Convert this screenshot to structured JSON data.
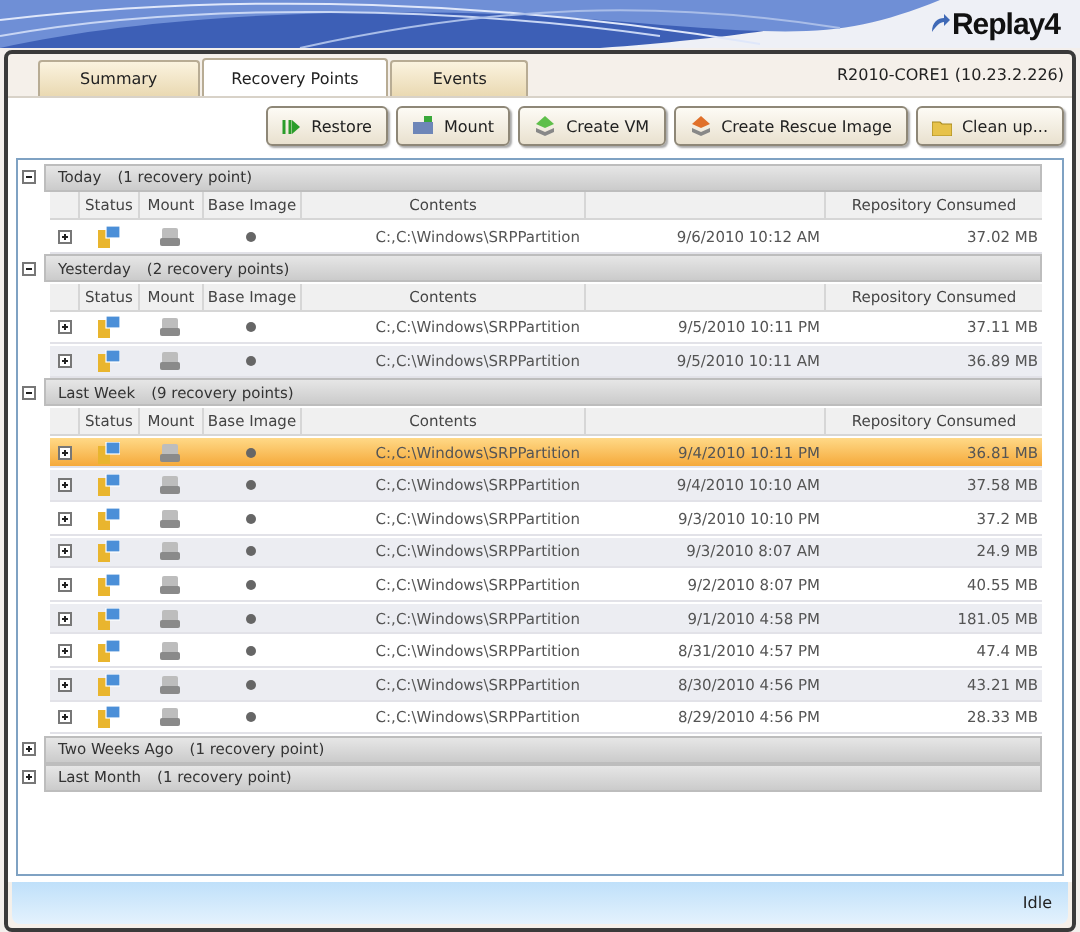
{
  "logo": "Replay4",
  "tabs": [
    {
      "label": "Summary",
      "selected": false
    },
    {
      "label": "Recovery Points",
      "selected": true
    },
    {
      "label": "Events",
      "selected": false
    }
  ],
  "server": "R2010-CORE1 (10.23.2.226)",
  "buttons": [
    {
      "label": "Restore",
      "kind": "restore"
    },
    {
      "label": "Mount",
      "kind": "mount"
    },
    {
      "label": "Create VM",
      "kind": "vm"
    },
    {
      "label": "Create Rescue Image",
      "kind": "rescue"
    },
    {
      "label": "Clean up...",
      "kind": "clean"
    }
  ],
  "groups": [
    {
      "title": "Today",
      "count": "(1 recovery point)",
      "expanded": true,
      "columns": [
        "Status",
        "Mount",
        "Base Image",
        "Contents",
        "Repository Consumed"
      ],
      "rows": [
        {
          "contents": "C:,C:\\Windows\\SRPPartition",
          "date": "9/6/2010 10:12 AM",
          "size": "37.02 MB",
          "selected": false
        }
      ]
    },
    {
      "title": "Yesterday",
      "count": "(2 recovery points)",
      "expanded": true,
      "columns": [
        "Status",
        "Mount",
        "Base Image",
        "Contents",
        "Repository Consumed"
      ],
      "rows": [
        {
          "contents": "C:,C:\\Windows\\SRPPartition",
          "date": "9/5/2010 10:11 PM",
          "size": "37.11 MB",
          "selected": false
        },
        {
          "contents": "C:,C:\\Windows\\SRPPartition",
          "date": "9/5/2010 10:11 AM",
          "size": "36.89 MB",
          "selected": false
        }
      ]
    },
    {
      "title": "Last Week",
      "count": "(9 recovery points)",
      "expanded": true,
      "columns": [
        "Status",
        "Mount",
        "Base Image",
        "Contents",
        "Repository Consumed"
      ],
      "rows": [
        {
          "contents": "C:,C:\\Windows\\SRPPartition",
          "date": "9/4/2010 10:11 PM",
          "size": "36.81 MB",
          "selected": true
        },
        {
          "contents": "C:,C:\\Windows\\SRPPartition",
          "date": "9/4/2010 10:10 AM",
          "size": "37.58 MB",
          "selected": false
        },
        {
          "contents": "C:,C:\\Windows\\SRPPartition",
          "date": "9/3/2010 10:10 PM",
          "size": "37.2 MB",
          "selected": false
        },
        {
          "contents": "C:,C:\\Windows\\SRPPartition",
          "date": "9/3/2010 8:07 AM",
          "size": "24.9 MB",
          "selected": false
        },
        {
          "contents": "C:,C:\\Windows\\SRPPartition",
          "date": "9/2/2010 8:07 PM",
          "size": "40.55 MB",
          "selected": false
        },
        {
          "contents": "C:,C:\\Windows\\SRPPartition",
          "date": "9/1/2010 4:58 PM",
          "size": "181.05 MB",
          "selected": false
        },
        {
          "contents": "C:,C:\\Windows\\SRPPartition",
          "date": "8/31/2010 4:57 PM",
          "size": "47.4 MB",
          "selected": false
        },
        {
          "contents": "C:,C:\\Windows\\SRPPartition",
          "date": "8/30/2010 4:56 PM",
          "size": "43.21 MB",
          "selected": false
        },
        {
          "contents": "C:,C:\\Windows\\SRPPartition",
          "date": "8/29/2010 4:56 PM",
          "size": "28.33 MB",
          "selected": false
        }
      ]
    },
    {
      "title": "Two Weeks Ago",
      "count": "(1 recovery point)",
      "expanded": false
    },
    {
      "title": "Last Month",
      "count": "(1 recovery point)",
      "expanded": false
    }
  ],
  "status": "Idle"
}
